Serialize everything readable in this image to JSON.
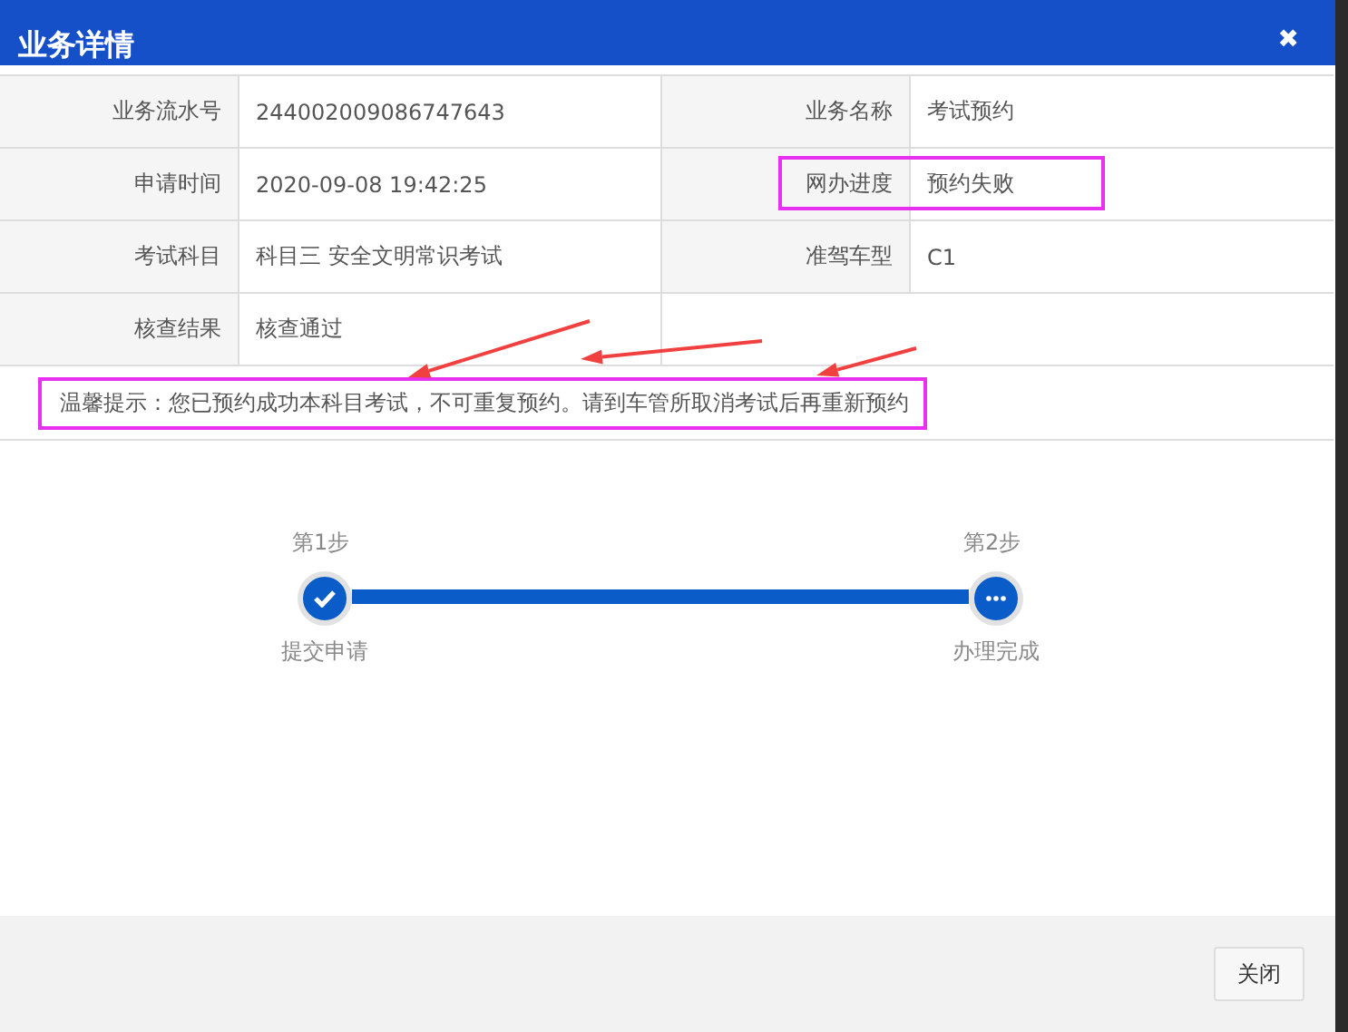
{
  "dialog": {
    "title": "业务详情",
    "close_icon": "✖"
  },
  "fields": [
    {
      "label": "业务流水号",
      "value": "244002009086747643",
      "highlighted": false
    },
    {
      "label": "业务名称",
      "value": "考试预约",
      "highlighted": false
    },
    {
      "label": "申请时间",
      "value": "2020-09-08 19:42:25",
      "highlighted": false
    },
    {
      "label": "网办进度",
      "value": "预约失败",
      "highlighted": true
    },
    {
      "label": "考试科目",
      "value": "科目三 安全文明常识考试",
      "highlighted": false
    },
    {
      "label": "准驾车型",
      "value": "C1",
      "highlighted": false
    },
    {
      "label": "核查结果",
      "value": "核查通过",
      "highlighted": false
    }
  ],
  "notice": {
    "text": "温馨提示：您已预约成功本科目考试，不可重复预约。请到车管所取消考试后再重新预约",
    "highlighted": true
  },
  "arrows": [
    {
      "kind": "arrow"
    },
    {
      "kind": "arrow"
    },
    {
      "kind": "arrow"
    }
  ],
  "steps": [
    {
      "step": "第1步",
      "label": "提交申请",
      "done": true
    },
    {
      "step": "第2步",
      "label": "办理完成",
      "done": false
    }
  ],
  "progress": {
    "level": 1
  },
  "buttons": [
    "关闭"
  ]
}
